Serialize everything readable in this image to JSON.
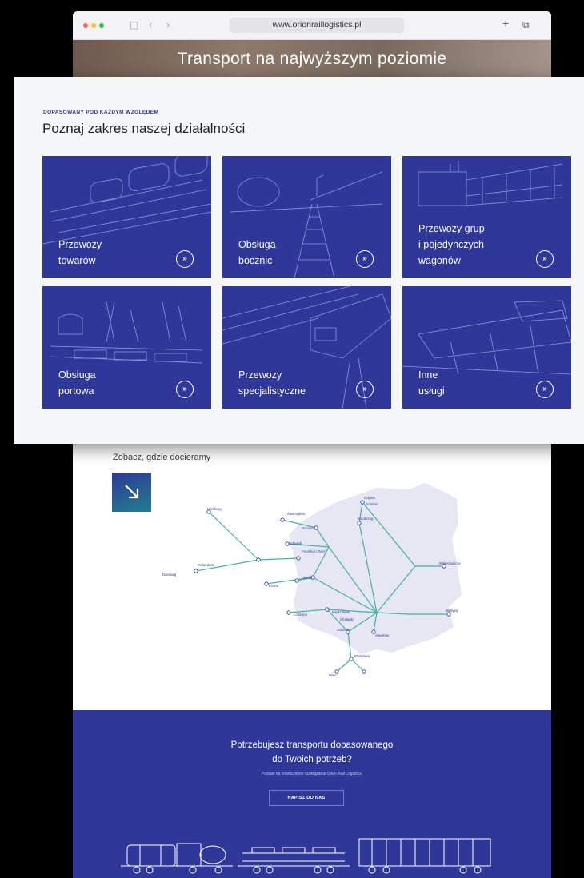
{
  "browser": {
    "url": "www.orionraillogistics.pl",
    "traffic_colors": [
      "#ff5f57",
      "#febc2e",
      "#28c840"
    ]
  },
  "hero": {
    "title": "Transport na najwyższym poziomie"
  },
  "services": {
    "eyebrow": "DOPASOWANY POD KAŻDYM WZGLĘDEM",
    "title": "Poznaj zakres naszej działalności",
    "tiles": [
      {
        "label": "Przewozy\ntowarów",
        "icon": "double-chevron-right-icon"
      },
      {
        "label": "Obsługa\nbocznic",
        "icon": "double-chevron-right-icon"
      },
      {
        "label": "Przewozy grup\ni pojedynczych\nwagonów",
        "icon": "double-chevron-right-icon"
      },
      {
        "label": "Obsługa\nportowa",
        "icon": "double-chevron-right-icon"
      },
      {
        "label": "Przewozy\nspecjalistyczne",
        "icon": "double-chevron-right-icon"
      },
      {
        "label": "Inne\nusługi",
        "icon": "double-chevron-right-icon"
      }
    ],
    "tile_color": "#2f3899"
  },
  "map": {
    "heading": "Zobacz, gdzie docieramy",
    "button_icon": "arrow-down-right-icon",
    "cities": [
      {
        "name": "Gdynia"
      },
      {
        "name": "Gdańsk"
      },
      {
        "name": "Hamburg"
      },
      {
        "name": "Świnoujście"
      },
      {
        "name": "Szczecin"
      },
      {
        "name": "Kołobrzeg"
      },
      {
        "name": "Schwedt"
      },
      {
        "name": "Frankfurt (Oder)"
      },
      {
        "name": "Rotterdam"
      },
      {
        "name": "Duisburg"
      },
      {
        "name": "Berlin"
      },
      {
        "name": "Leuna"
      },
      {
        "name": "Lovosice"
      },
      {
        "name": "Małaszewicze"
      },
      {
        "name": "Medyka"
      },
      {
        "name": "Chałupki"
      },
      {
        "name": "Ostrava"
      },
      {
        "name": "Międzylesie"
      },
      {
        "name": "Sławków"
      },
      {
        "name": "Wien"
      },
      {
        "name": "Bratislava"
      }
    ]
  },
  "cta": {
    "title_line1": "Potrzebujesz transportu dopasowanego",
    "title_line2": "do Twoich potrzeb?",
    "subtitle": "Postaw na nowoczesne rozwiązania Orion Rail Logistics.",
    "button": "NAPISZ DO NAS"
  }
}
